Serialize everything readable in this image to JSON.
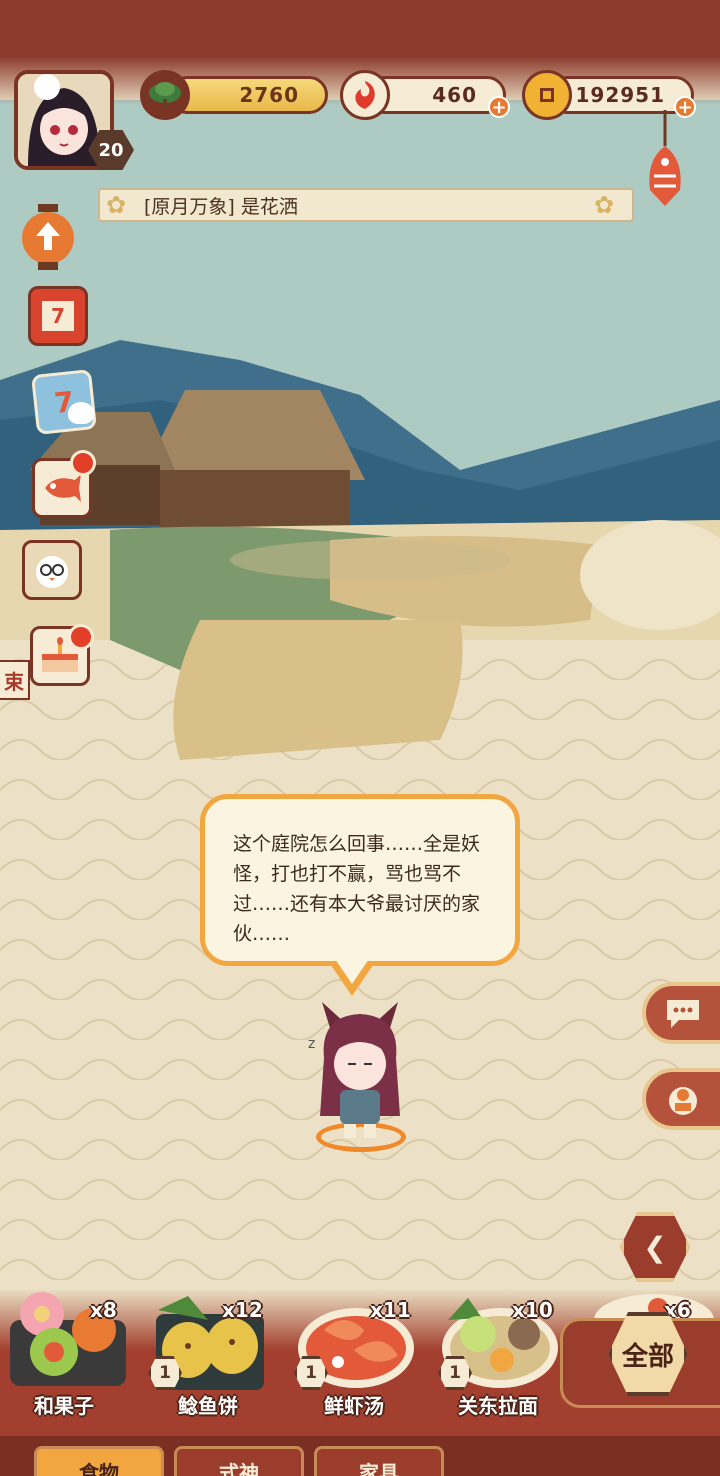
{
  "player": {
    "level": "20"
  },
  "resources": [
    {
      "name": "pine",
      "value": "2760",
      "icon": "pine-icon"
    },
    {
      "name": "energy",
      "value": "460",
      "icon": "flame-swirl-icon"
    },
    {
      "name": "coins",
      "value": "192951",
      "icon": "coin-icon"
    }
  ],
  "announcement": {
    "text": "[原月万象] 是花洒"
  },
  "side_menu": [
    {
      "name": "levelup-lantern",
      "icon": "lantern-up-icon",
      "label": ""
    },
    {
      "name": "calendar",
      "icon": "calendar-icon",
      "label": "7"
    },
    {
      "name": "event-card",
      "icon": "event-card-icon",
      "label": "7"
    },
    {
      "name": "fish-flag",
      "icon": "koinobori-icon"
    },
    {
      "name": "newspaper-owl",
      "icon": "owl-icon"
    },
    {
      "name": "cake",
      "icon": "cake-icon"
    }
  ],
  "side_tag": "束",
  "speech": {
    "text": "这个庭院怎么回事……全是妖怪，打也打不赢，骂也骂不过……还有本大爷最讨厌的家伙……"
  },
  "food_items": [
    {
      "label": "和果子",
      "count": "x8",
      "level": ""
    },
    {
      "label": "鲶鱼饼",
      "count": "x12",
      "level": "1"
    },
    {
      "label": "鲜虾汤",
      "count": "x11",
      "level": "1"
    },
    {
      "label": "关东拉面",
      "count": "x10",
      "level": "1"
    },
    {
      "label": "",
      "count": "x6",
      "level": ""
    }
  ],
  "all_button": "全部",
  "tabs": [
    "食物",
    "式神",
    "家具"
  ],
  "colors": {
    "accent": "#f1a640",
    "brand_red": "#9a3d2c",
    "paper": "#e9ddc1",
    "sky": "#a8c9c3"
  }
}
